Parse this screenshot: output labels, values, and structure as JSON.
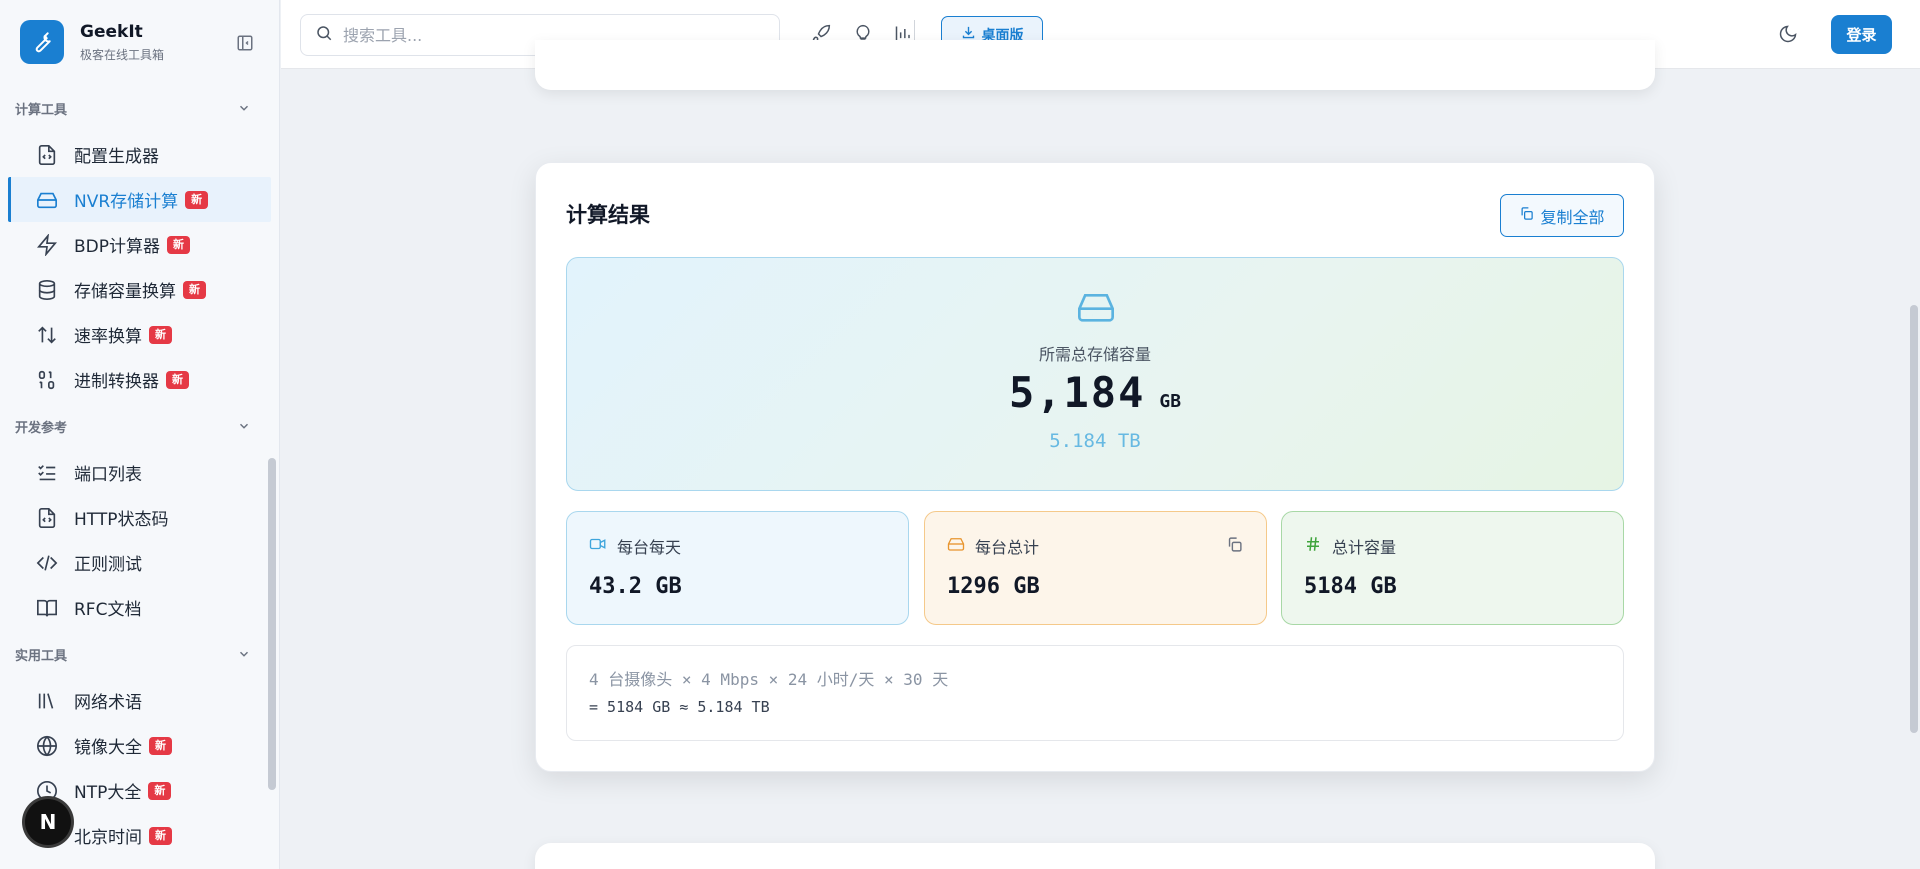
{
  "brand": {
    "name": "GeekIt",
    "subtitle": "极客在线工具箱"
  },
  "sidebar": {
    "sections": [
      {
        "title": "计算工具",
        "items": [
          {
            "label": "配置生成器",
            "icon": "code-file-icon",
            "badge": ""
          },
          {
            "label": "NVR存储计算",
            "icon": "hard-drive-icon",
            "badge": "新",
            "active": true
          },
          {
            "label": "BDP计算器",
            "icon": "lightning-icon",
            "badge": "新"
          },
          {
            "label": "存储容量换算",
            "icon": "database-icon",
            "badge": "新"
          },
          {
            "label": "速率换算",
            "icon": "arrows-up-down-icon",
            "badge": "新"
          },
          {
            "label": "进制转换器",
            "icon": "binary-icon",
            "badge": "新"
          }
        ]
      },
      {
        "title": "开发参考",
        "items": [
          {
            "label": "端口列表",
            "icon": "checklist-icon",
            "badge": ""
          },
          {
            "label": "HTTP状态码",
            "icon": "code-file-icon",
            "badge": ""
          },
          {
            "label": "正则测试",
            "icon": "code-brackets-icon",
            "badge": ""
          },
          {
            "label": "RFC文档",
            "icon": "book-icon",
            "badge": ""
          }
        ]
      },
      {
        "title": "实用工具",
        "items": [
          {
            "label": "网络术语",
            "icon": "library-icon",
            "badge": ""
          },
          {
            "label": "镜像大全",
            "icon": "globe-icon",
            "badge": "新"
          },
          {
            "label": "NTP大全",
            "icon": "clock-icon",
            "badge": "新"
          },
          {
            "label": "北京时间",
            "icon": "clock-icon",
            "badge": "新"
          }
        ]
      }
    ]
  },
  "header": {
    "search_placeholder": "搜索工具...",
    "desktop_label": "桌面版",
    "login_label": "登录"
  },
  "result": {
    "title": "计算结果",
    "copy_all_label": "复制全部",
    "total_label": "所需总存储容量",
    "total_value": "5,184",
    "total_unit": "GB",
    "total_sub": "5.184 TB",
    "stats": [
      {
        "label": "每台每天",
        "value": "43.2 GB",
        "icon": "video-camera-icon"
      },
      {
        "label": "每台总计",
        "value": "1296 GB",
        "icon": "hard-drive-icon"
      },
      {
        "label": "总计容量",
        "value": "5184 GB",
        "icon": "hash-icon"
      }
    ],
    "formula_line1": "4 台摄像头 × 4 Mbps × 24 小时/天 × 30 天",
    "formula_line2": "= 5184 GB ≈ 5.184 TB"
  },
  "colors": {
    "accent": "#1a7fd1",
    "badge": "#e53945"
  }
}
